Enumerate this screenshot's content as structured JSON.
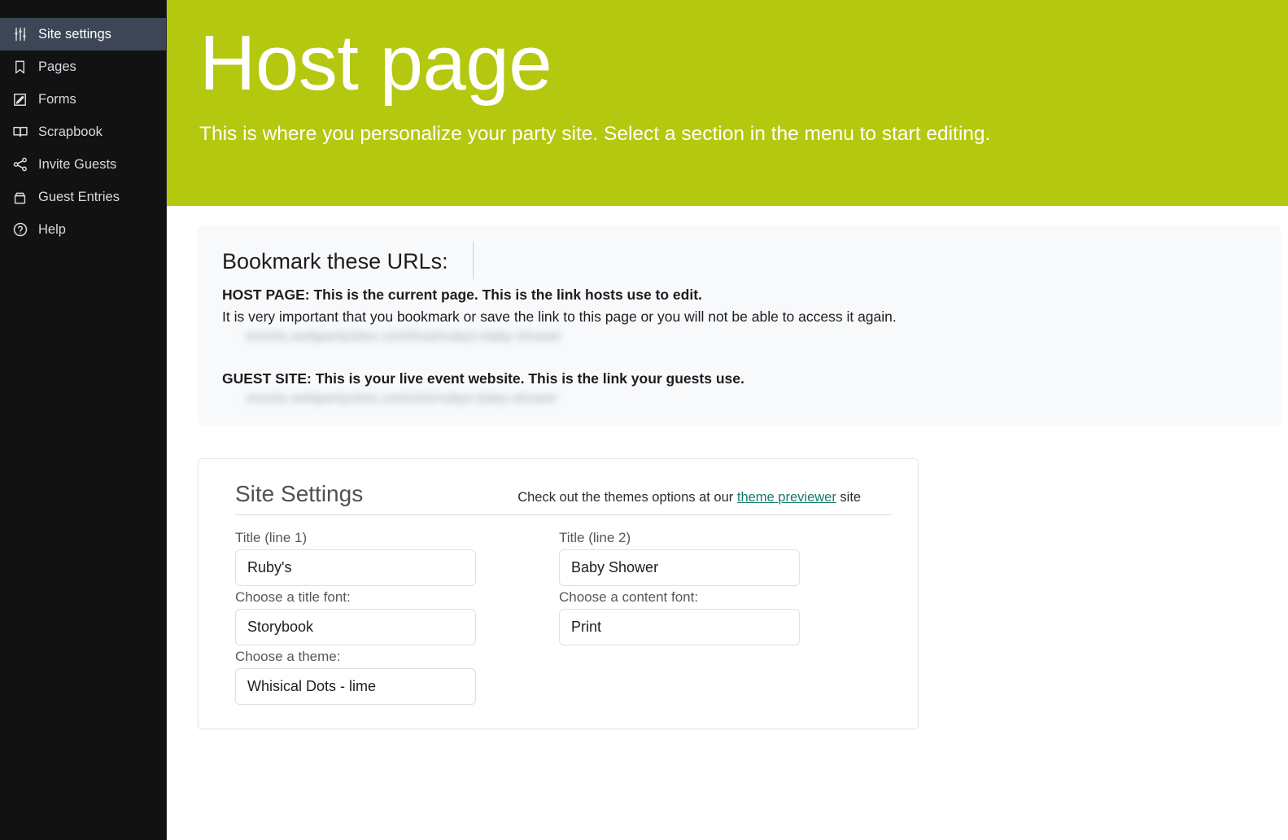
{
  "sidebar": {
    "items": [
      {
        "label": "Site settings",
        "icon": "sliders-icon",
        "active": true
      },
      {
        "label": "Pages",
        "icon": "bookmark-icon",
        "active": false
      },
      {
        "label": "Forms",
        "icon": "edit-square-icon",
        "active": false
      },
      {
        "label": "Scrapbook",
        "icon": "open-book-icon",
        "active": false
      },
      {
        "label": "Invite Guests",
        "icon": "share-nodes-icon",
        "active": false
      },
      {
        "label": "Guest Entries",
        "icon": "inbox-archive-icon",
        "active": false
      },
      {
        "label": "Help",
        "icon": "question-circle-icon",
        "active": false
      }
    ]
  },
  "header": {
    "title": "Host page",
    "subtitle": "This is where you personalize your party site. Select a section in the menu to start editing.",
    "background_color": "#b4c80f"
  },
  "bookmark_card": {
    "title": "Bookmark these URLs:",
    "host_page_label": "HOST PAGE: This is the current page. This is the link hosts use to edit.",
    "host_page_note": "It is very important that you bookmark or save the link to this page or you will not be able to access it again.",
    "host_page_url": "events.webpartysites.com/host/rubys-baby-shower",
    "guest_site_label": "GUEST SITE: This is your live event website. This is the link your guests use.",
    "guest_site_url": "events.webpartysites.com/site/rubys-baby-shower"
  },
  "settings_card": {
    "title": "Site Settings",
    "themes_note_prefix": "Check out the themes options at our ",
    "themes_link": "theme previewer",
    "themes_note_suffix": " site",
    "link_color": "#16796a",
    "fields": [
      {
        "label": "Title (line 1)",
        "value": "Ruby's"
      },
      {
        "label": "Title (line 2)",
        "value": "Baby Shower"
      },
      {
        "label": "Choose a title font:",
        "value": "Storybook"
      },
      {
        "label": "Choose a content font:",
        "value": "Print"
      },
      {
        "label": "Choose a theme:",
        "value": "Whisical Dots - lime"
      }
    ]
  }
}
